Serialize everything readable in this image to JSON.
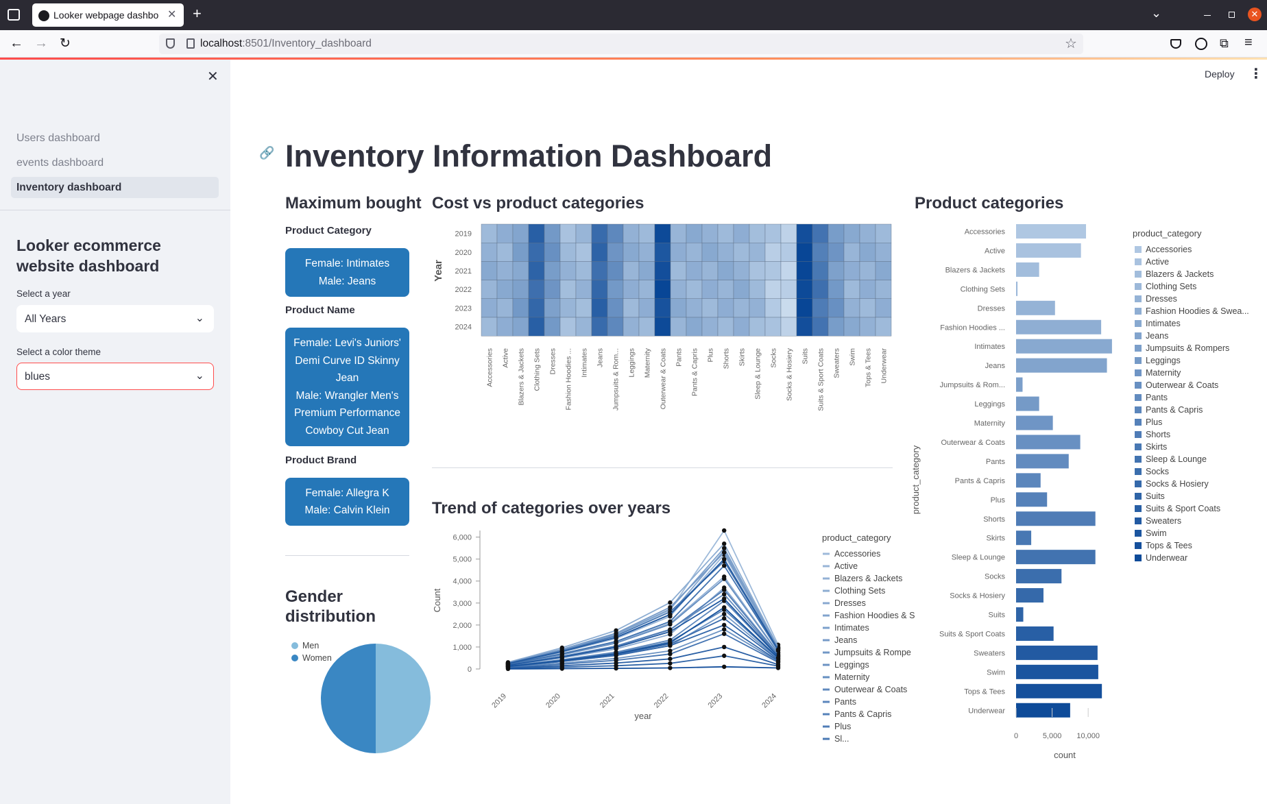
{
  "browser": {
    "tab_title": "Looker webpage dashbo",
    "url_host": "localhost",
    "url_path": ":8501/Inventory_dashboard"
  },
  "header": {
    "deploy_label": "Deploy"
  },
  "sidebar": {
    "nav": [
      "Users dashboard",
      "events dashboard",
      "Inventory dashboard"
    ],
    "title": "Looker ecommerce website dashboard",
    "year_label": "Select a year",
    "year_value": "All Years",
    "theme_label": "Select a color theme",
    "theme_value": "blues"
  },
  "main": {
    "title": "Inventory Information Dashboard",
    "max_bought": {
      "heading": "Maximum bought",
      "category_label": "Product Category",
      "category_lines": [
        "Female: Intimates",
        "Male: Jeans"
      ],
      "name_label": "Product Name",
      "name_lines": [
        "Female: Levi's Juniors'",
        "Demi Curve ID Skinny",
        "Jean",
        "Male: Wrangler Men's",
        "Premium Performance",
        "Cowboy Cut Jean"
      ],
      "brand_label": "Product Brand",
      "brand_lines": [
        "Female: Allegra K",
        "Male: Calvin Klein"
      ]
    },
    "gender_heading_lines": [
      "Gender",
      "distribution"
    ],
    "heatmap_heading": "Cost vs product categories",
    "trend_heading": "Trend of categories over years",
    "bar_heading": "Product categories"
  },
  "categories_full": [
    "Accessories",
    "Active",
    "Blazers & Jackets",
    "Clothing Sets",
    "Dresses",
    "Fashion Hoodies & Swea...",
    "Intimates",
    "Jeans",
    "Jumpsuits & Rompers",
    "Leggings",
    "Maternity",
    "Outerwear & Coats",
    "Pants",
    "Pants & Capris",
    "Plus",
    "Shorts",
    "Skirts",
    "Sleep & Lounge",
    "Socks",
    "Socks & Hosiery",
    "Suits",
    "Suits & Sport Coats",
    "Sweaters",
    "Swim",
    "Tops & Tees",
    "Underwear"
  ],
  "categories_heat": [
    "Accessories",
    "Active",
    "Blazers & Jackets",
    "Clothing Sets",
    "Dresses",
    "Fashion Hoodies ...",
    "Intimates",
    "Jeans",
    "Jumpsuits & Rom...",
    "Leggings",
    "Maternity",
    "Outerwear & Coats",
    "Pants",
    "Pants & Capris",
    "Plus",
    "Shorts",
    "Skirts",
    "Sleep & Lounge",
    "Socks",
    "Socks & Hosiery",
    "Suits",
    "Suits & Sport Coats",
    "Sweaters",
    "Swim",
    "Tops & Tees",
    "Underwear"
  ],
  "categories_bar": [
    "Accessories",
    "Active",
    "Blazers & Jackets",
    "Clothing Sets",
    "Dresses",
    "Fashion Hoodies ...",
    "Intimates",
    "Jeans",
    "Jumpsuits & Rom...",
    "Leggings",
    "Maternity",
    "Outerwear & Coats",
    "Pants",
    "Pants & Capris",
    "Plus",
    "Shorts",
    "Skirts",
    "Sleep & Lounge",
    "Socks",
    "Socks & Hosiery",
    "Suits",
    "Suits & Sport Coats",
    "Sweaters",
    "Swim",
    "Tops & Tees",
    "Underwear"
  ],
  "categories_trend_legend": [
    "Accessories",
    "Active",
    "Blazers & Jackets",
    "Clothing Sets",
    "Dresses",
    "Fashion Hoodies & S",
    "Intimates",
    "Jeans",
    "Jumpsuits & Rompe",
    "Leggings",
    "Maternity",
    "Outerwear & Coats",
    "Pants",
    "Pants & Capris",
    "Plus",
    "Sl..."
  ],
  "colors": {
    "accent": "#2577b8",
    "blues_scale": [
      "#c6dbef",
      "#a9cfe6",
      "#9ecae1",
      "#85bcdc",
      "#6baed6",
      "#4292c6",
      "#2b7bbb",
      "#2171b5",
      "#11559b",
      "#08519c"
    ]
  },
  "chart_data": [
    {
      "type": "heatmap",
      "title": "Cost vs product categories",
      "ylabel": "Year",
      "y": [
        "2019",
        "2020",
        "2021",
        "2022",
        "2023",
        "2024"
      ],
      "x_ref": "categories_heat",
      "column_intensity": [
        0.35,
        0.35,
        0.45,
        0.8,
        0.5,
        0.3,
        0.3,
        0.8,
        0.55,
        0.35,
        0.35,
        0.95,
        0.35,
        0.35,
        0.35,
        0.35,
        0.35,
        0.3,
        0.2,
        0.15,
        1.0,
        0.7,
        0.5,
        0.35,
        0.35,
        0.35
      ]
    },
    {
      "type": "bar",
      "title": "Product categories",
      "xlabel": "count",
      "ylabel": "product_category",
      "xlim": [
        0,
        13500
      ],
      "x_ticks": [
        "0",
        "5,000",
        "10,000"
      ],
      "values": [
        9700,
        9000,
        3200,
        200,
        5400,
        11800,
        13300,
        12600,
        900,
        3200,
        5100,
        8900,
        7300,
        3400,
        4300,
        11000,
        2100,
        11000,
        6300,
        3800,
        1000,
        5200,
        11300,
        11400,
        11900,
        7500
      ]
    },
    {
      "type": "line",
      "title": "Trend of categories over years",
      "xlabel": "year",
      "ylabel": "Count",
      "x": [
        "2019",
        "2020",
        "2021",
        "2022",
        "2023",
        "2024"
      ],
      "ylim": [
        0,
        6300
      ],
      "y_ticks": [
        "0",
        "1,000",
        "2,000",
        "3,000",
        "4,000",
        "5,000",
        "6,000"
      ],
      "legend_title": "product_category",
      "series_peak_2023": [
        6300,
        5200,
        4200,
        5700,
        3700,
        5400,
        5500,
        5300,
        2500,
        1800,
        4100,
        3400,
        3100,
        2700,
        3600,
        4900,
        1600,
        4700,
        2300,
        2000,
        600,
        1000,
        5000,
        3200,
        2800,
        100
      ]
    },
    {
      "type": "pie",
      "legend": [
        "Men",
        "Women"
      ],
      "values": [
        50,
        50
      ],
      "colors": [
        "#85bcdc",
        "#3a87c3"
      ]
    }
  ]
}
